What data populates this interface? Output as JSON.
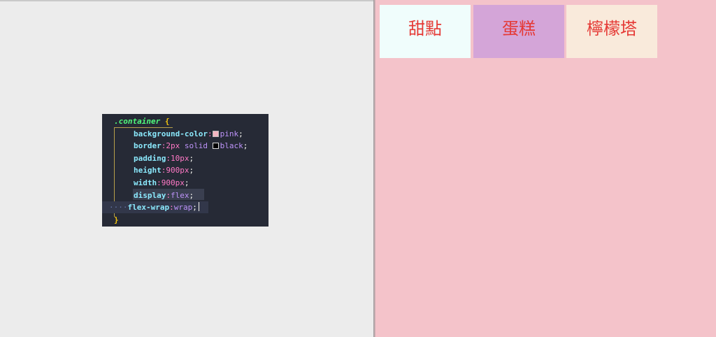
{
  "code": {
    "selector": ".container",
    "open_brace": "{",
    "close_brace": "}",
    "declarations": [
      {
        "prop": "background-color",
        "value": "pink",
        "swatch": "#f4b6c2"
      },
      {
        "prop": "border",
        "value_parts": [
          "2px",
          "solid"
        ],
        "value": "black",
        "swatch": "#000000"
      },
      {
        "prop": "padding",
        "value": "10px"
      },
      {
        "prop": "height",
        "value": "900px"
      },
      {
        "prop": "width",
        "value": "900px"
      },
      {
        "prop": "display",
        "value": "flex"
      },
      {
        "prop": "flex-wrap",
        "value": "wrap"
      }
    ]
  },
  "preview": {
    "background": "#f4c3ca",
    "items": [
      {
        "label": "甜點",
        "bg": "#f0fdfc"
      },
      {
        "label": "蛋糕",
        "bg": "#d4a5d8"
      },
      {
        "label": "檸檬塔",
        "bg": "#f9eadb"
      }
    ]
  }
}
